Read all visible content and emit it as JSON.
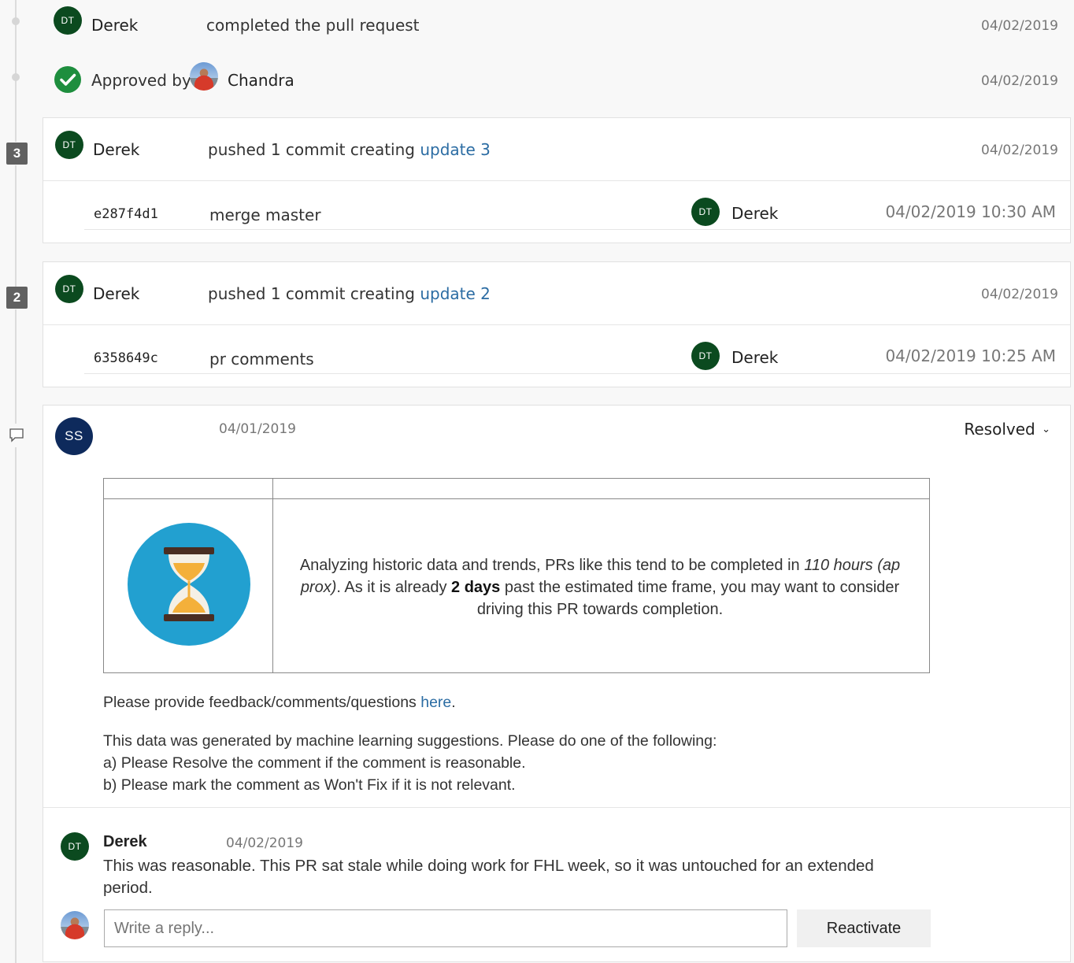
{
  "timeline": [
    {
      "avatar": "DT",
      "name": "Derek",
      "action": "completed the pull request",
      "date": "04/02/2019"
    },
    {
      "approved_label": "Approved by",
      "name": "Chandra",
      "date": "04/02/2019"
    }
  ],
  "updates": [
    {
      "badge": "3",
      "avatar": "DT",
      "name": "Derek",
      "action": "pushed 1 commit creating ",
      "link": "update 3",
      "date": "04/02/2019",
      "commit": {
        "hash": "e287f4d1",
        "message": "merge master",
        "avatar": "DT",
        "author": "Derek",
        "datetime": "04/02/2019 10:30 AM"
      }
    },
    {
      "badge": "2",
      "avatar": "DT",
      "name": "Derek",
      "action": "pushed 1 commit creating ",
      "link": "update 2",
      "date": "04/02/2019",
      "commit": {
        "hash": "6358649c",
        "message": "pr comments",
        "avatar": "DT",
        "author": "Derek",
        "datetime": "04/02/2019 10:25 AM"
      }
    }
  ],
  "thread": {
    "avatar": "SS",
    "date": "04/01/2019",
    "status": "Resolved",
    "insight": {
      "p1": "Analyzing historic data and trends, PRs like this tend to be completed in ",
      "hours": "110 hours (ap prox)",
      "p2": ". As it is already ",
      "days": "2 days",
      "p3": " past the estimated time frame, you may want to consider driving this PR towards completion."
    },
    "feedback_text": "Please provide feedback/comments/questions ",
    "feedback_link": "here",
    "feedback_end": ".",
    "ml_line1": "This data was generated by machine learning suggestions. Please do one of the following:",
    "ml_line2": "a) Please Resolve the comment if the comment is reasonable.",
    "ml_line3": "b) Please mark the comment as Won't Fix if it is not relevant.",
    "reply": {
      "avatar": "DT",
      "name": "Derek",
      "date": "04/02/2019",
      "text": "This was reasonable. This PR sat stale while doing work for FHL week, so it was untouched for an extended period."
    },
    "reply_placeholder": "Write a reply...",
    "reactivate_label": "Reactivate"
  },
  "colors": {
    "link": "#2b6ca3",
    "avatar_green": "#0b4a1f",
    "avatar_navy": "#0e2a5c",
    "approved_green": "#1e8e3e",
    "hourglass_bg": "#22a0d0"
  }
}
